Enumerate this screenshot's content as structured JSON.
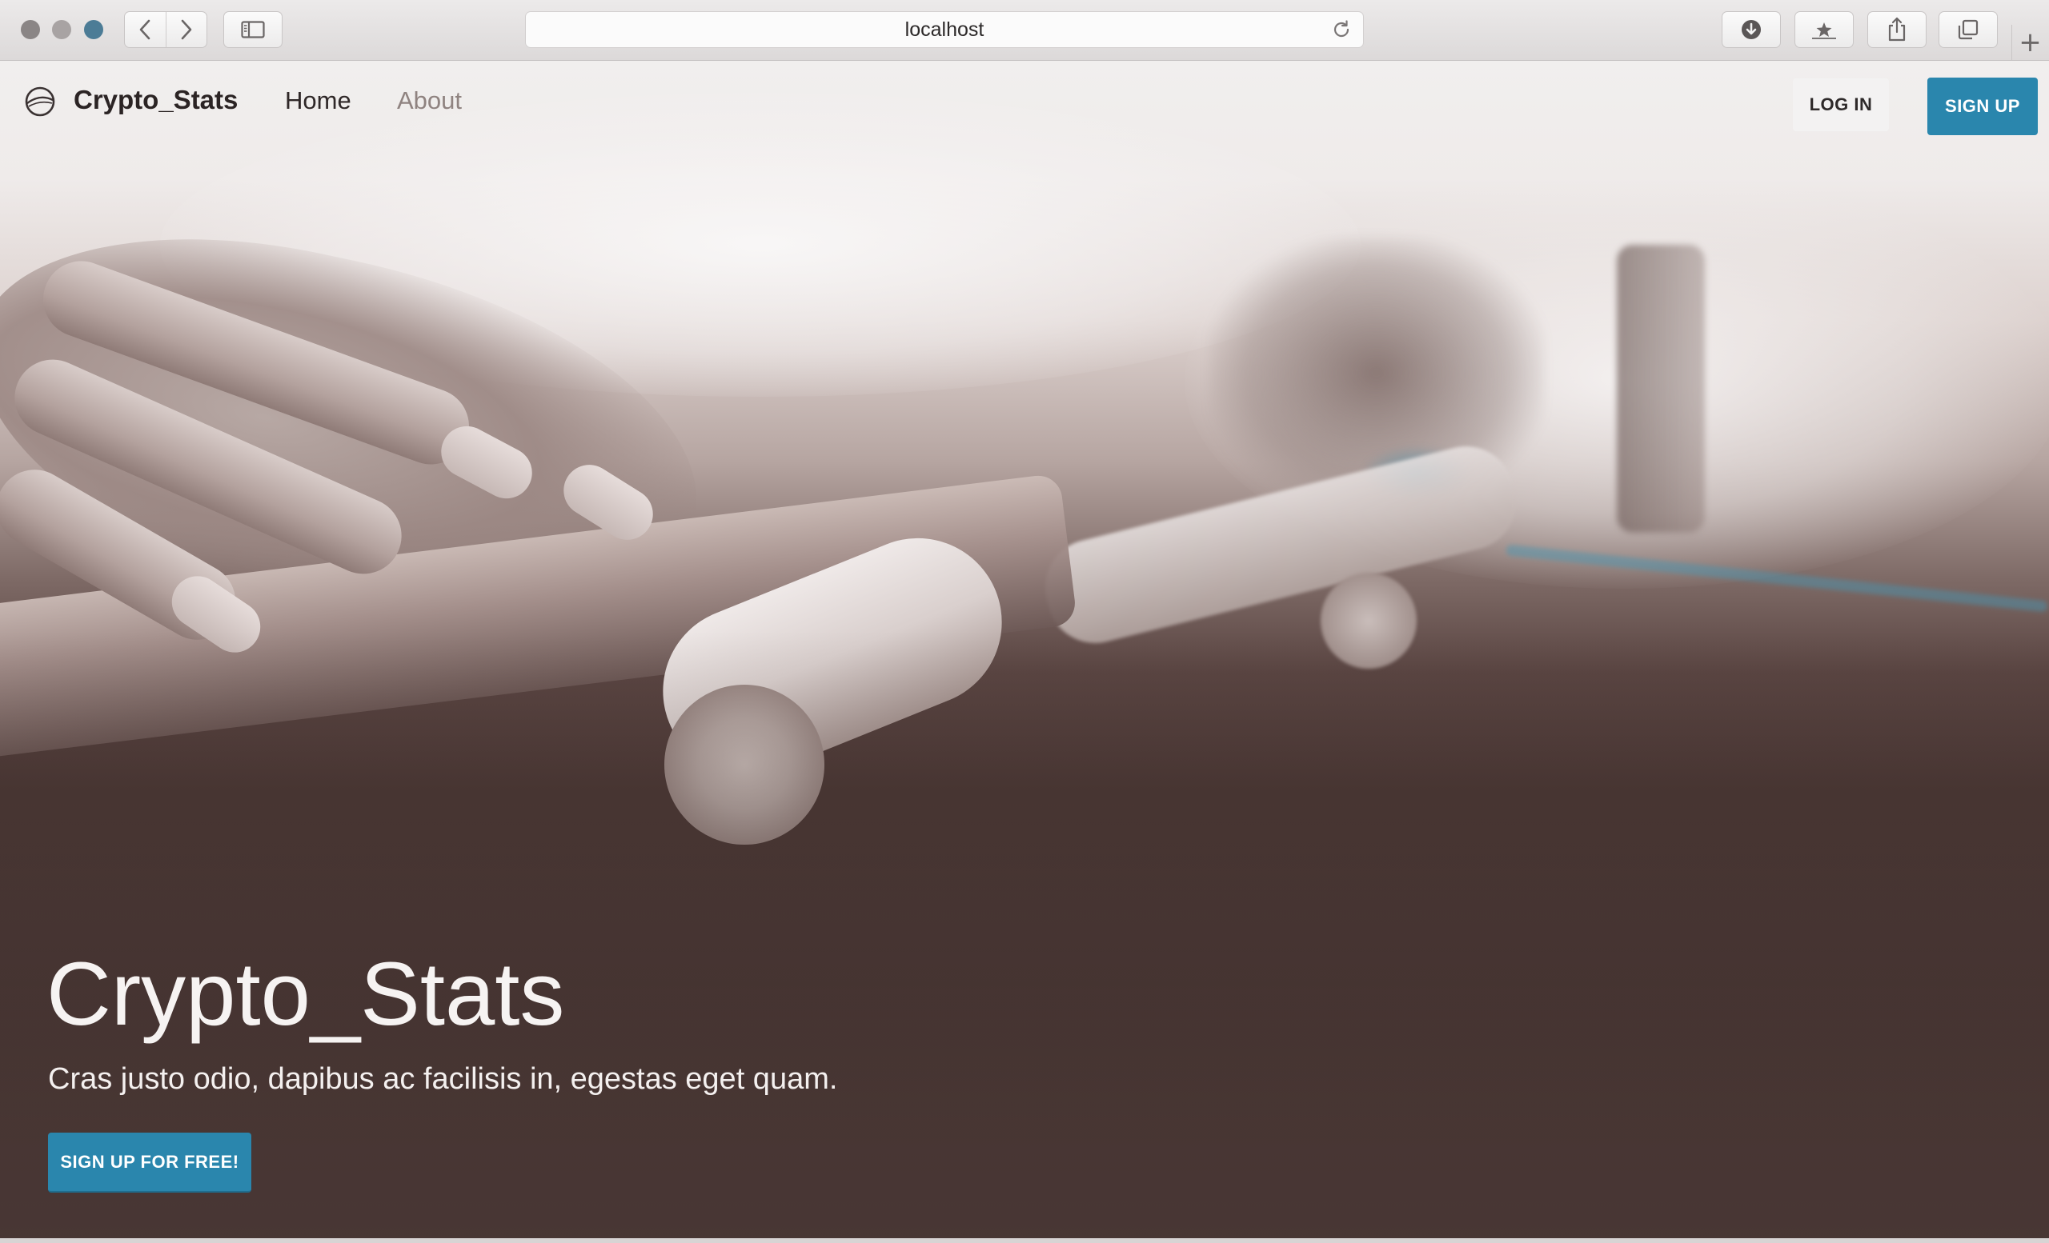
{
  "browser": {
    "url": "localhost",
    "icons": {
      "back": "chevron-left-icon",
      "forward": "chevron-right-icon",
      "sidebar": "sidebar-icon",
      "reload": "reload-icon",
      "downloads": "download-icon",
      "bookmarks": "bookmark-star-icon",
      "share": "share-icon",
      "tabs": "tabs-overview-icon",
      "new_tab": "plus-icon"
    },
    "new_tab_glyph": "+"
  },
  "navbar": {
    "brand": "Crypto_Stats",
    "links": [
      {
        "label": "Home"
      },
      {
        "label": "About"
      }
    ],
    "login_label": "LOG IN",
    "signup_label": "SIGN UP"
  },
  "hero": {
    "title": "Crypto_Stats",
    "subtitle": "Cras justo odio, dapibus ac facilisis in, egestas eget quam.",
    "cta_label": "SIGN UP FOR FREE!"
  },
  "colors": {
    "accent": "#2a86ad",
    "brand_text": "#2b2424",
    "nav_muted": "#8f8380",
    "hero_text": "#f6f3f2"
  }
}
